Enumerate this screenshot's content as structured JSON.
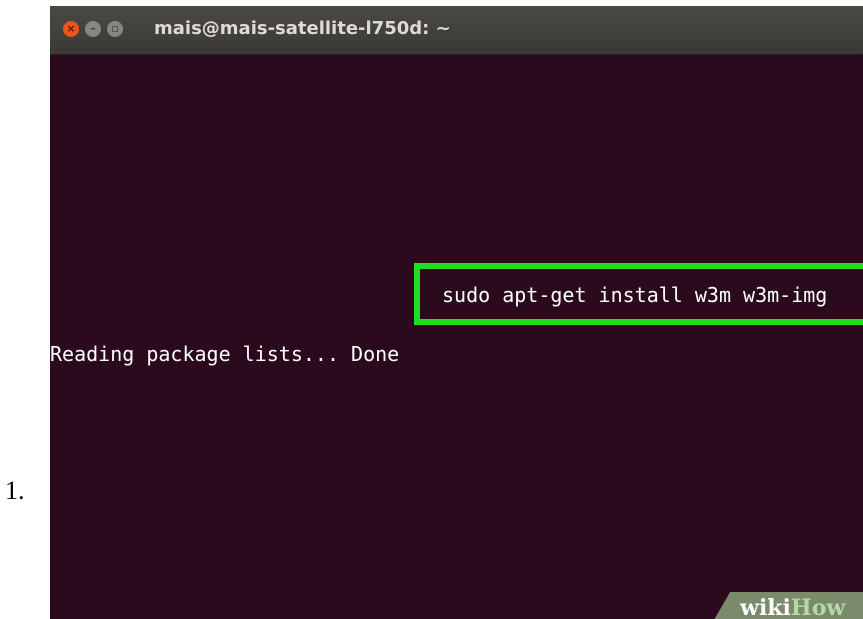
{
  "list": {
    "marker": "1."
  },
  "window": {
    "title": "mais@mais-satellite-l750d: ~",
    "buttons": {
      "close_icon": "close-icon",
      "minimize_icon": "minimize-icon",
      "maximize_icon": "maximize-icon"
    }
  },
  "terminal": {
    "command": "sudo apt-get install w3m w3m-img",
    "output": "Reading package lists... Done"
  },
  "watermark": {
    "part1": "wiki",
    "part2": "How"
  },
  "colors": {
    "terminal_bg": "#2c0a1e",
    "highlight": "#1ee01e",
    "close_button": "#e9541f"
  }
}
